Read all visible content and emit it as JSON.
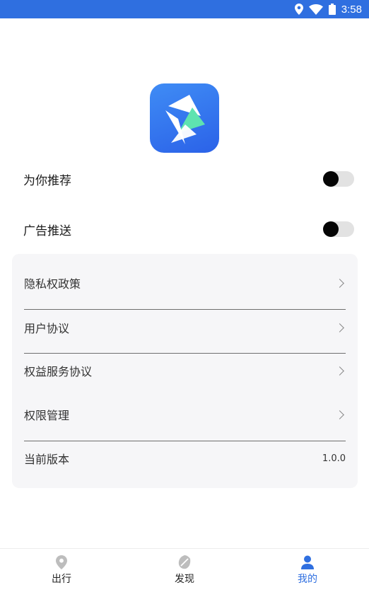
{
  "status_bar": {
    "time": "3:58",
    "icons": [
      "location-icon",
      "wifi-icon",
      "battery-icon"
    ]
  },
  "logo": {
    "icon": "app-logo-icon"
  },
  "settings": {
    "recommend_label": "为你推荐",
    "recommend_enabled": false,
    "ads_label": "广告推送",
    "ads_enabled": false
  },
  "menu": {
    "items": [
      {
        "label": "隐私权政策"
      },
      {
        "label": "用户协议"
      },
      {
        "label": "权益服务协议"
      },
      {
        "label": "权限管理"
      }
    ],
    "version_label": "当前版本",
    "version_value": "1.0.0"
  },
  "tab_bar": {
    "tabs": [
      {
        "label": "出行",
        "icon": "map-pin-icon"
      },
      {
        "label": "发现",
        "icon": "discover-leaf-icon"
      },
      {
        "label": "我的",
        "icon": "person-icon"
      }
    ],
    "active": "我的"
  },
  "colors": {
    "accent": "#2f6fe0",
    "logo_green": "#5ee3b0",
    "card_bg": "#f6f6f8"
  }
}
